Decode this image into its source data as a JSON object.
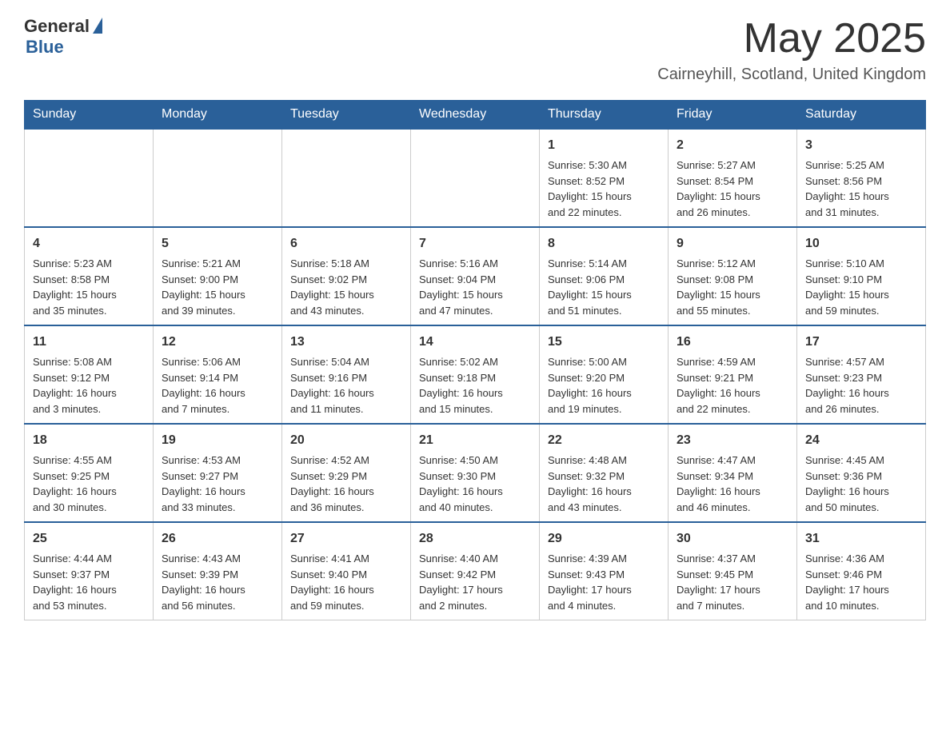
{
  "header": {
    "logo_general": "General",
    "logo_blue": "Blue",
    "month_year": "May 2025",
    "location": "Cairneyhill, Scotland, United Kingdom"
  },
  "days_of_week": [
    "Sunday",
    "Monday",
    "Tuesday",
    "Wednesday",
    "Thursday",
    "Friday",
    "Saturday"
  ],
  "weeks": [
    [
      {
        "day": "",
        "info": ""
      },
      {
        "day": "",
        "info": ""
      },
      {
        "day": "",
        "info": ""
      },
      {
        "day": "",
        "info": ""
      },
      {
        "day": "1",
        "info": "Sunrise: 5:30 AM\nSunset: 8:52 PM\nDaylight: 15 hours\nand 22 minutes."
      },
      {
        "day": "2",
        "info": "Sunrise: 5:27 AM\nSunset: 8:54 PM\nDaylight: 15 hours\nand 26 minutes."
      },
      {
        "day": "3",
        "info": "Sunrise: 5:25 AM\nSunset: 8:56 PM\nDaylight: 15 hours\nand 31 minutes."
      }
    ],
    [
      {
        "day": "4",
        "info": "Sunrise: 5:23 AM\nSunset: 8:58 PM\nDaylight: 15 hours\nand 35 minutes."
      },
      {
        "day": "5",
        "info": "Sunrise: 5:21 AM\nSunset: 9:00 PM\nDaylight: 15 hours\nand 39 minutes."
      },
      {
        "day": "6",
        "info": "Sunrise: 5:18 AM\nSunset: 9:02 PM\nDaylight: 15 hours\nand 43 minutes."
      },
      {
        "day": "7",
        "info": "Sunrise: 5:16 AM\nSunset: 9:04 PM\nDaylight: 15 hours\nand 47 minutes."
      },
      {
        "day": "8",
        "info": "Sunrise: 5:14 AM\nSunset: 9:06 PM\nDaylight: 15 hours\nand 51 minutes."
      },
      {
        "day": "9",
        "info": "Sunrise: 5:12 AM\nSunset: 9:08 PM\nDaylight: 15 hours\nand 55 minutes."
      },
      {
        "day": "10",
        "info": "Sunrise: 5:10 AM\nSunset: 9:10 PM\nDaylight: 15 hours\nand 59 minutes."
      }
    ],
    [
      {
        "day": "11",
        "info": "Sunrise: 5:08 AM\nSunset: 9:12 PM\nDaylight: 16 hours\nand 3 minutes."
      },
      {
        "day": "12",
        "info": "Sunrise: 5:06 AM\nSunset: 9:14 PM\nDaylight: 16 hours\nand 7 minutes."
      },
      {
        "day": "13",
        "info": "Sunrise: 5:04 AM\nSunset: 9:16 PM\nDaylight: 16 hours\nand 11 minutes."
      },
      {
        "day": "14",
        "info": "Sunrise: 5:02 AM\nSunset: 9:18 PM\nDaylight: 16 hours\nand 15 minutes."
      },
      {
        "day": "15",
        "info": "Sunrise: 5:00 AM\nSunset: 9:20 PM\nDaylight: 16 hours\nand 19 minutes."
      },
      {
        "day": "16",
        "info": "Sunrise: 4:59 AM\nSunset: 9:21 PM\nDaylight: 16 hours\nand 22 minutes."
      },
      {
        "day": "17",
        "info": "Sunrise: 4:57 AM\nSunset: 9:23 PM\nDaylight: 16 hours\nand 26 minutes."
      }
    ],
    [
      {
        "day": "18",
        "info": "Sunrise: 4:55 AM\nSunset: 9:25 PM\nDaylight: 16 hours\nand 30 minutes."
      },
      {
        "day": "19",
        "info": "Sunrise: 4:53 AM\nSunset: 9:27 PM\nDaylight: 16 hours\nand 33 minutes."
      },
      {
        "day": "20",
        "info": "Sunrise: 4:52 AM\nSunset: 9:29 PM\nDaylight: 16 hours\nand 36 minutes."
      },
      {
        "day": "21",
        "info": "Sunrise: 4:50 AM\nSunset: 9:30 PM\nDaylight: 16 hours\nand 40 minutes."
      },
      {
        "day": "22",
        "info": "Sunrise: 4:48 AM\nSunset: 9:32 PM\nDaylight: 16 hours\nand 43 minutes."
      },
      {
        "day": "23",
        "info": "Sunrise: 4:47 AM\nSunset: 9:34 PM\nDaylight: 16 hours\nand 46 minutes."
      },
      {
        "day": "24",
        "info": "Sunrise: 4:45 AM\nSunset: 9:36 PM\nDaylight: 16 hours\nand 50 minutes."
      }
    ],
    [
      {
        "day": "25",
        "info": "Sunrise: 4:44 AM\nSunset: 9:37 PM\nDaylight: 16 hours\nand 53 minutes."
      },
      {
        "day": "26",
        "info": "Sunrise: 4:43 AM\nSunset: 9:39 PM\nDaylight: 16 hours\nand 56 minutes."
      },
      {
        "day": "27",
        "info": "Sunrise: 4:41 AM\nSunset: 9:40 PM\nDaylight: 16 hours\nand 59 minutes."
      },
      {
        "day": "28",
        "info": "Sunrise: 4:40 AM\nSunset: 9:42 PM\nDaylight: 17 hours\nand 2 minutes."
      },
      {
        "day": "29",
        "info": "Sunrise: 4:39 AM\nSunset: 9:43 PM\nDaylight: 17 hours\nand 4 minutes."
      },
      {
        "day": "30",
        "info": "Sunrise: 4:37 AM\nSunset: 9:45 PM\nDaylight: 17 hours\nand 7 minutes."
      },
      {
        "day": "31",
        "info": "Sunrise: 4:36 AM\nSunset: 9:46 PM\nDaylight: 17 hours\nand 10 minutes."
      }
    ]
  ]
}
